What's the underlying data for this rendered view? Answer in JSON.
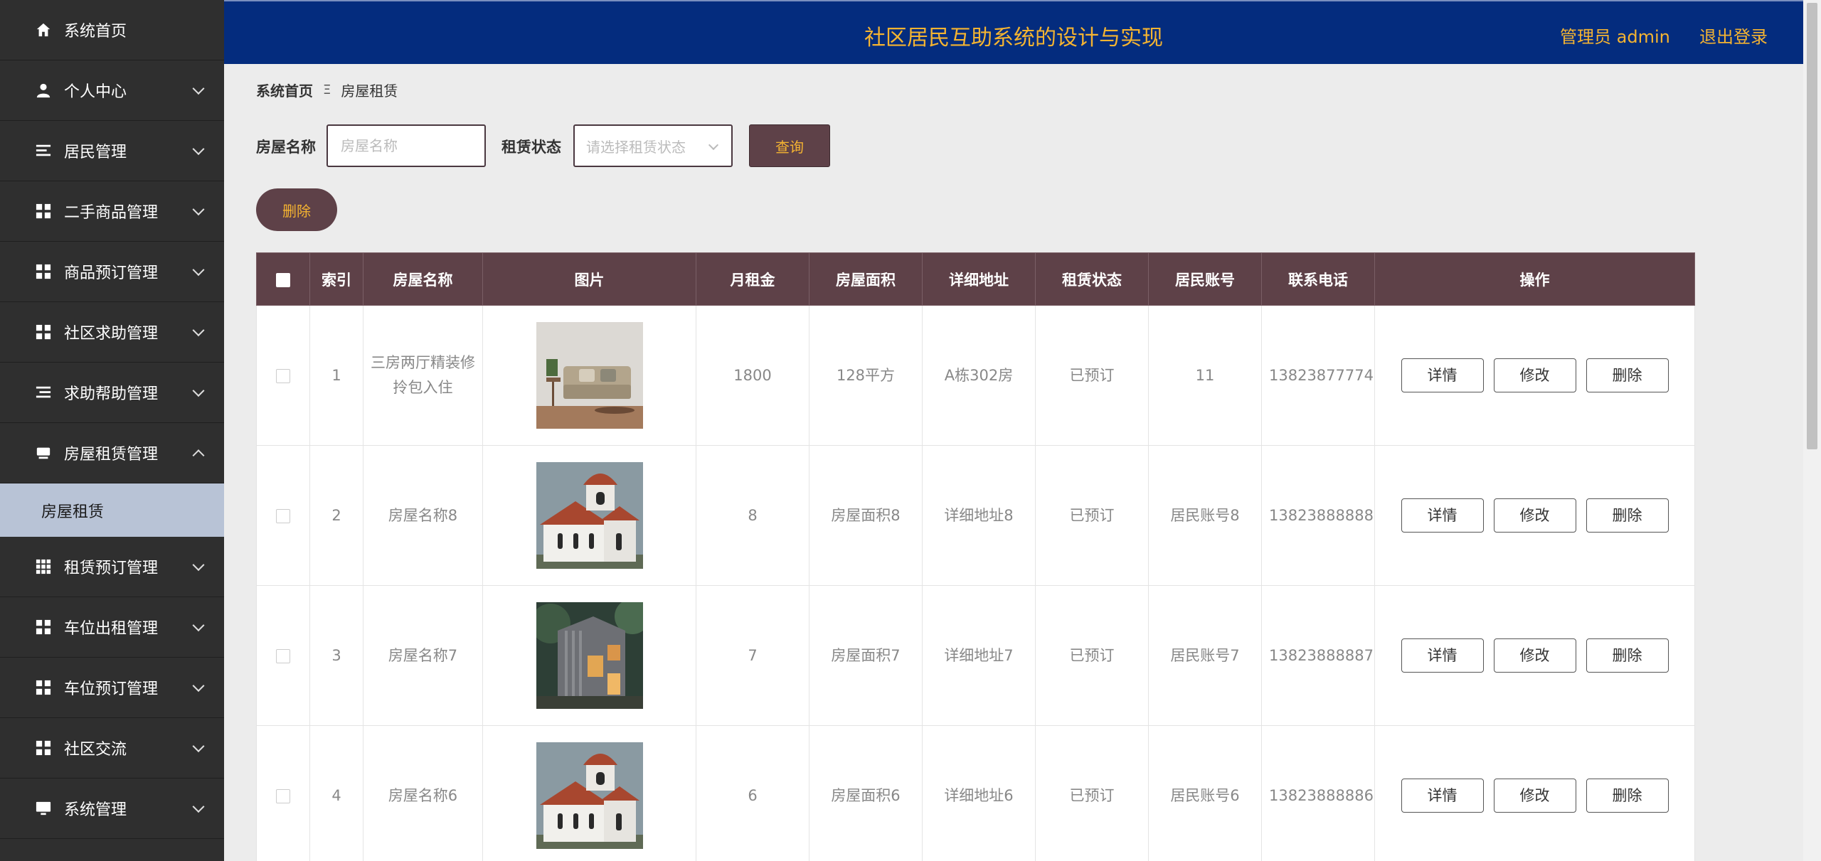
{
  "header": {
    "title": "社区居民互助系统的设计与实现",
    "admin": "管理员 admin",
    "logout": "退出登录"
  },
  "sidebar": {
    "items": [
      {
        "label": "系统首页",
        "icon": "home-icon"
      },
      {
        "label": "个人中心",
        "icon": "user-icon"
      },
      {
        "label": "居民管理",
        "icon": "list-icon"
      },
      {
        "label": "二手商品管理",
        "icon": "grid-icon"
      },
      {
        "label": "商品预订管理",
        "icon": "grid-icon"
      },
      {
        "label": "社区求助管理",
        "icon": "grid-icon"
      },
      {
        "label": "求助帮助管理",
        "icon": "list-icon"
      },
      {
        "label": "房屋租赁管理",
        "icon": "house-icon"
      },
      {
        "label": "租赁预订管理",
        "icon": "apps-icon"
      },
      {
        "label": "车位出租管理",
        "icon": "grid-icon"
      },
      {
        "label": "车位预订管理",
        "icon": "grid-icon"
      },
      {
        "label": "社区交流",
        "icon": "grid-icon"
      },
      {
        "label": "系统管理",
        "icon": "monitor-icon"
      }
    ],
    "sub_item": "房屋租赁"
  },
  "breadcrumb": {
    "home": "系统首页",
    "separator": "Ξ",
    "current": "房屋租赁"
  },
  "search": {
    "name_label": "房屋名称",
    "name_placeholder": "房屋名称",
    "status_label": "租赁状态",
    "status_placeholder": "请选择租赁状态",
    "query_button": "查询"
  },
  "actions": {
    "delete_button": "删除"
  },
  "table": {
    "headers": [
      "索引",
      "房屋名称",
      "图片",
      "月租金",
      "房屋面积",
      "详细地址",
      "租赁状态",
      "居民账号",
      "联系电话",
      "操作"
    ],
    "rows": [
      {
        "index": "1",
        "name": "三房两厅精装修拎包入住",
        "image": "living-room-photo",
        "rent": "1800",
        "area": "128平方",
        "address": "A栋302房",
        "status": "已预订",
        "account": "11",
        "phone": "13823877774"
      },
      {
        "index": "2",
        "name": "房屋名称8",
        "image": "chapel-photo",
        "rent": "8",
        "area": "房屋面积8",
        "address": "详细地址8",
        "status": "已预订",
        "account": "居民账号8",
        "phone": "13823888888"
      },
      {
        "index": "3",
        "name": "房屋名称7",
        "image": "modern-house-photo",
        "rent": "7",
        "area": "房屋面积7",
        "address": "详细地址7",
        "status": "已预订",
        "account": "居民账号7",
        "phone": "13823888887"
      },
      {
        "index": "4",
        "name": "房屋名称6",
        "image": "chapel-photo",
        "rent": "6",
        "area": "房屋面积6",
        "address": "详细地址6",
        "status": "已预订",
        "account": "居民账号6",
        "phone": "13823888886"
      }
    ],
    "op_labels": {
      "detail": "详情",
      "edit": "修改",
      "delete": "删除"
    }
  },
  "colors": {
    "sidebar_bg": "#2f2f2f",
    "header_bg": "#042c7e",
    "accent": "#f5b431",
    "table_header_bg": "#5e4148",
    "active_sub_bg": "#b8c3d6"
  }
}
